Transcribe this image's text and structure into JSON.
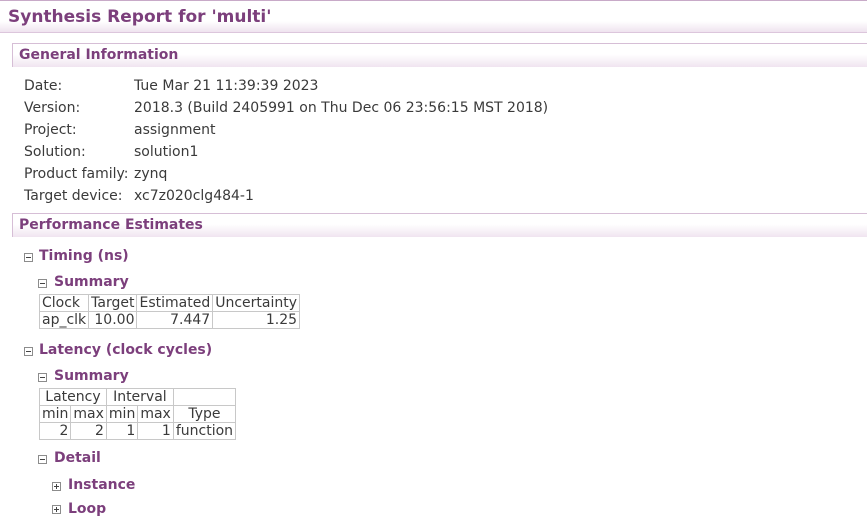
{
  "title": "Synthesis Report for 'multi'",
  "general": {
    "header": "General Information",
    "rows": [
      {
        "label": "Date:",
        "value": "Tue Mar 21 11:39:39 2023"
      },
      {
        "label": "Version:",
        "value": "2018.3 (Build 2405991 on Thu Dec 06 23:56:15 MST 2018)"
      },
      {
        "label": "Project:",
        "value": "assignment"
      },
      {
        "label": "Solution:",
        "value": "solution1"
      },
      {
        "label": "Product family:",
        "value": "zynq"
      },
      {
        "label": "Target device:",
        "value": "xc7z020clg484-1"
      }
    ]
  },
  "performance": {
    "header": "Performance Estimates",
    "timing": {
      "label": "Timing (ns)",
      "summary_label": "Summary",
      "columns": [
        "Clock",
        "Target",
        "Estimated",
        "Uncertainty"
      ],
      "row": [
        "ap_clk",
        "10.00",
        "7.447",
        "1.25"
      ]
    },
    "latency": {
      "label": "Latency (clock cycles)",
      "summary_label": "Summary",
      "group_headers": [
        "Latency",
        "Interval"
      ],
      "sub_headers": [
        "min",
        "max",
        "min",
        "max",
        "Type"
      ],
      "row": [
        "2",
        "2",
        "1",
        "1",
        "function"
      ],
      "detail_label": "Detail",
      "instance_label": "Instance",
      "loop_label": "Loop"
    }
  }
}
